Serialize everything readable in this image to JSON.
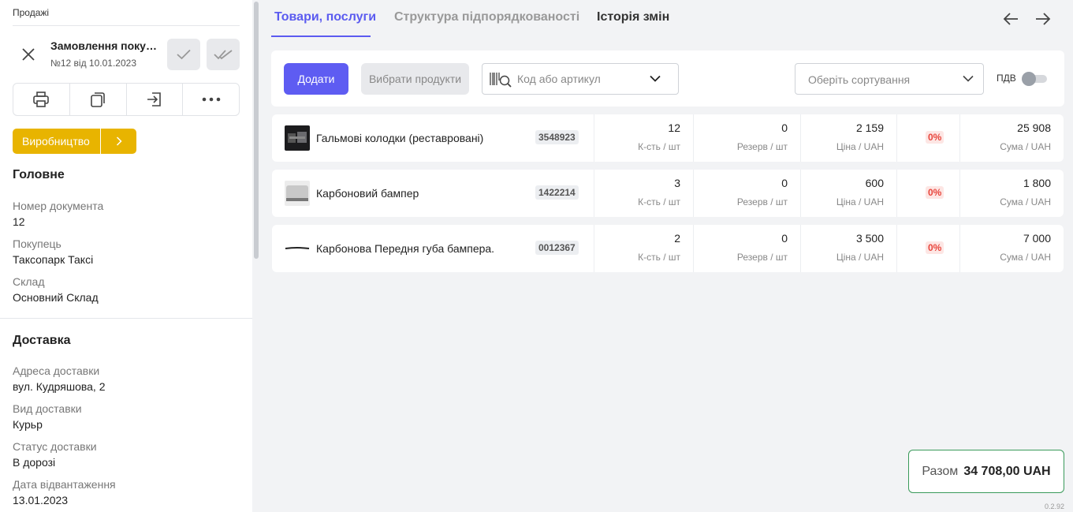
{
  "sidebar": {
    "breadcrumb": "Продажі",
    "doc_title": "Замовлення покуп...",
    "doc_subtitle": "№12 від 10.01.2023",
    "status_label": "Виробництво",
    "sections": {
      "main_title": "Головне",
      "fields": [
        {
          "label": "Номер документа",
          "value": "12"
        },
        {
          "label": "Покупець",
          "value": "Таксопарк Таксі"
        },
        {
          "label": "Склад",
          "value": "Основний Склад"
        }
      ],
      "delivery_title": "Доставка",
      "delivery_fields": [
        {
          "label": "Адреса доставки",
          "value": "вул. Кудряшова, 2"
        },
        {
          "label": "Вид доставки",
          "value": "Курьр"
        },
        {
          "label": "Статус доставки",
          "value": "В дорозі"
        },
        {
          "label": "Дата відвантаження",
          "value": "13.01.2023"
        }
      ]
    },
    "icons": [
      "close-icon",
      "check-icon",
      "double-check-icon",
      "print-icon",
      "copy-icon",
      "export-icon",
      "more-icon",
      "chevron-right-icon"
    ]
  },
  "tabs": [
    {
      "label": "Товари, послуги",
      "active": true
    },
    {
      "label": "Структура підпорядкованості",
      "active": false
    },
    {
      "label": "Історія змін",
      "active": false
    }
  ],
  "toolbar": {
    "add_label": "Додати",
    "select_label": "Вибрати продукти",
    "search_placeholder": "Код або артикул",
    "sort_placeholder": "Оберіть сортування",
    "vat_label": "ПДВ",
    "vat_enabled": false
  },
  "units": {
    "qty": "К-сть / шт",
    "reserve": "Резерв / шт",
    "price": "Ціна / UAH",
    "sum": "Сума / UAH"
  },
  "items": [
    {
      "name": "Гальмові колодки (рестав­ровані)",
      "code": "3548923",
      "qty": "12",
      "reserve": "0",
      "price": "2 159",
      "discount": "0%",
      "sum": "25 908"
    },
    {
      "name": "Карбоновий бампер",
      "code": "1422214",
      "qty": "3",
      "reserve": "0",
      "price": "600",
      "discount": "0%",
      "sum": "1 800"
    },
    {
      "name": "Карбонова Передня губа бампера.",
      "code": "0012367",
      "qty": "2",
      "reserve": "0",
      "price": "3 500",
      "discount": "0%",
      "sum": "7 000"
    }
  ],
  "total": {
    "label": "Разом",
    "value": "34 708,00 UAH"
  },
  "version": "0.2.92",
  "colors": {
    "accent": "#5e5cf2",
    "status": "#e8b400",
    "discount": "#e8453c",
    "total_border": "#3a9a5a"
  }
}
